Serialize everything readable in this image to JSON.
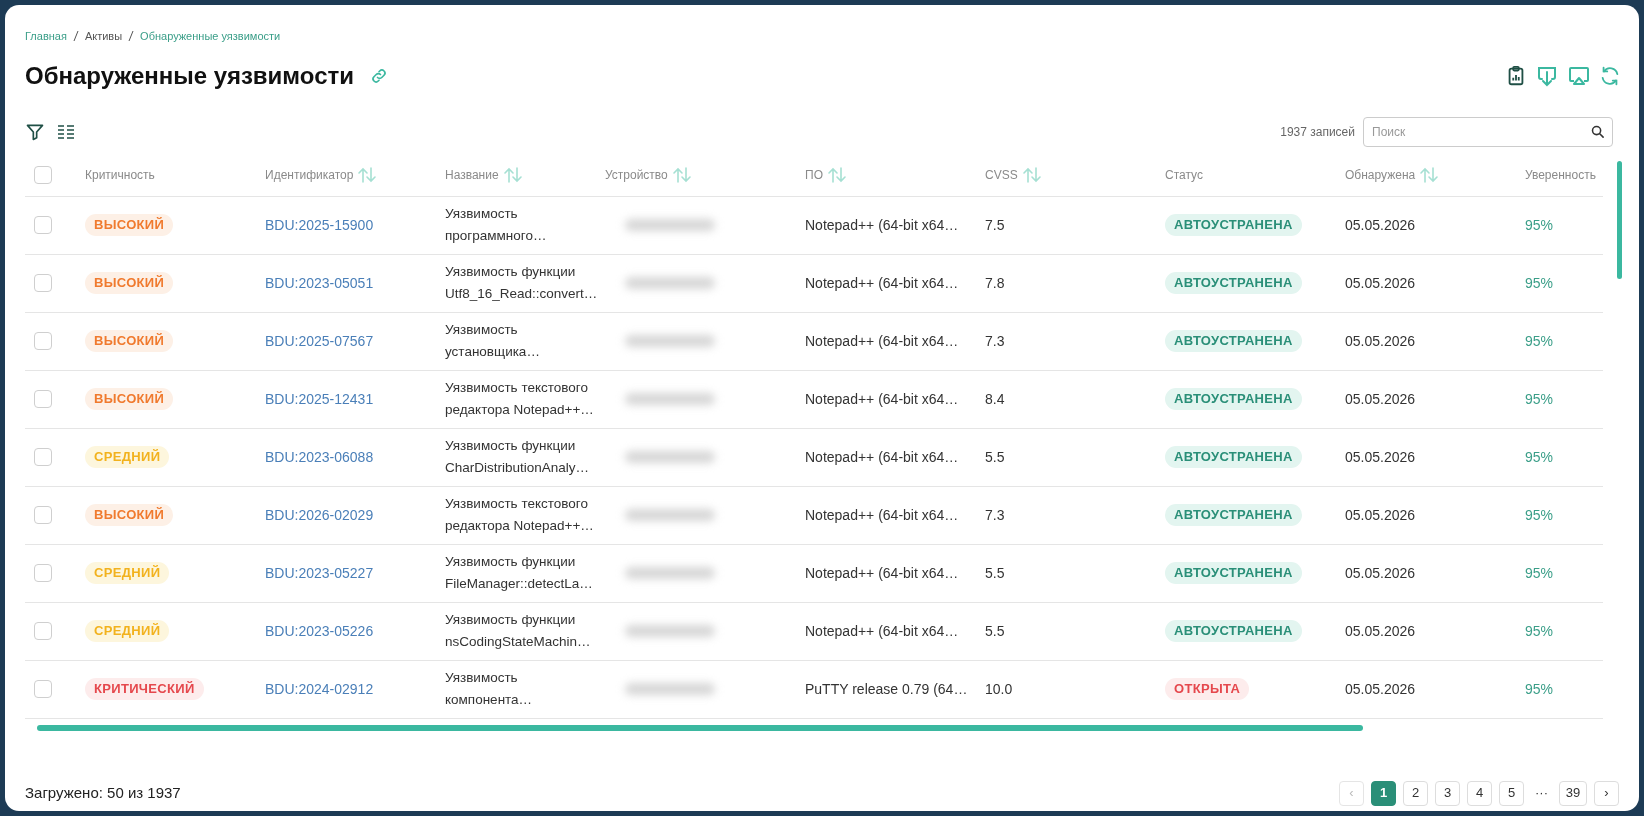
{
  "breadcrumbs": [
    {
      "label": "Главная",
      "kind": "link"
    },
    {
      "label": "Активы",
      "kind": "plain"
    },
    {
      "label": "Обнаруженные уязвимости",
      "kind": "link"
    }
  ],
  "title": "Обнаруженные уязвимости",
  "record_count": "1937 записей",
  "search": {
    "placeholder": "Поиск"
  },
  "table": {
    "select_all_checked": false,
    "columns": [
      {
        "label": "Критичность",
        "sortable": false
      },
      {
        "label": "Идентификатор",
        "sortable": true
      },
      {
        "label": "Название",
        "sortable": true
      },
      {
        "label": "Устройство",
        "sortable": true
      },
      {
        "label": "ПО",
        "sortable": true
      },
      {
        "label": "CVSS",
        "sortable": true
      },
      {
        "label": "Статус",
        "sortable": false
      },
      {
        "label": "Обнаружена",
        "sortable": true
      },
      {
        "label": "Уверенность",
        "sortable": false
      }
    ],
    "rows": [
      {
        "checked": false,
        "severity": {
          "label": "ВЫСОКИЙ",
          "kind": "high"
        },
        "id": "BDU:2025-15900",
        "name": "Уязвимость программного…",
        "software": "Notepad++ (64-bit x64…",
        "cvss": "7.5",
        "status": {
          "label": "АВТОУСТРАНЕНА",
          "kind": "fixed"
        },
        "found": "05.05.2026",
        "confidence": "95%"
      },
      {
        "checked": false,
        "severity": {
          "label": "ВЫСОКИЙ",
          "kind": "high"
        },
        "id": "BDU:2023-05051",
        "name": "Уязвимость функции Utf8_16_Read::convert…",
        "software": "Notepad++ (64-bit x64…",
        "cvss": "7.8",
        "status": {
          "label": "АВТОУСТРАНЕНА",
          "kind": "fixed"
        },
        "found": "05.05.2026",
        "confidence": "95%"
      },
      {
        "checked": false,
        "severity": {
          "label": "ВЫСОКИЙ",
          "kind": "high"
        },
        "id": "BDU:2025-07567",
        "name": "Уязвимость установщика…",
        "software": "Notepad++ (64-bit x64…",
        "cvss": "7.3",
        "status": {
          "label": "АВТОУСТРАНЕНА",
          "kind": "fixed"
        },
        "found": "05.05.2026",
        "confidence": "95%"
      },
      {
        "checked": false,
        "severity": {
          "label": "ВЫСОКИЙ",
          "kind": "high"
        },
        "id": "BDU:2025-12431",
        "name": "Уязвимость текстового редактора Notepad++…",
        "software": "Notepad++ (64-bit x64…",
        "cvss": "8.4",
        "status": {
          "label": "АВТОУСТРАНЕНА",
          "kind": "fixed"
        },
        "found": "05.05.2026",
        "confidence": "95%"
      },
      {
        "checked": false,
        "severity": {
          "label": "СРЕДНИЙ",
          "kind": "medium"
        },
        "id": "BDU:2023-06088",
        "name": "Уязвимость функции CharDistributionAnaly…",
        "software": "Notepad++ (64-bit x64…",
        "cvss": "5.5",
        "status": {
          "label": "АВТОУСТРАНЕНА",
          "kind": "fixed"
        },
        "found": "05.05.2026",
        "confidence": "95%"
      },
      {
        "checked": false,
        "severity": {
          "label": "ВЫСОКИЙ",
          "kind": "high"
        },
        "id": "BDU:2026-02029",
        "name": "Уязвимость текстового редактора Notepad++…",
        "software": "Notepad++ (64-bit x64…",
        "cvss": "7.3",
        "status": {
          "label": "АВТОУСТРАНЕНА",
          "kind": "fixed"
        },
        "found": "05.05.2026",
        "confidence": "95%"
      },
      {
        "checked": false,
        "severity": {
          "label": "СРЕДНИЙ",
          "kind": "medium"
        },
        "id": "BDU:2023-05227",
        "name": "Уязвимость функции FileManager::detectLa…",
        "software": "Notepad++ (64-bit x64…",
        "cvss": "5.5",
        "status": {
          "label": "АВТОУСТРАНЕНА",
          "kind": "fixed"
        },
        "found": "05.05.2026",
        "confidence": "95%"
      },
      {
        "checked": false,
        "severity": {
          "label": "СРЕДНИЙ",
          "kind": "medium"
        },
        "id": "BDU:2023-05226",
        "name": "Уязвимость функции nsCodingStateMachin…",
        "software": "Notepad++ (64-bit x64…",
        "cvss": "5.5",
        "status": {
          "label": "АВТОУСТРАНЕНА",
          "kind": "fixed"
        },
        "found": "05.05.2026",
        "confidence": "95%"
      },
      {
        "checked": false,
        "severity": {
          "label": "КРИТИЧЕСКИЙ",
          "kind": "critical"
        },
        "id": "BDU:2024-02912",
        "name": "Уязвимость компонента…",
        "software": "PuTTY release 0.79 (64…",
        "cvss": "10.0",
        "status": {
          "label": "ОТКРЫТА",
          "kind": "open"
        },
        "found": "05.05.2026",
        "confidence": "95%"
      }
    ]
  },
  "loaded": "Загружено: 50 из 1937",
  "pagination": {
    "prev": "‹",
    "next": "›",
    "ellipsis": "···",
    "pages": [
      {
        "label": "1",
        "selected": true
      },
      {
        "label": "2",
        "selected": false
      },
      {
        "label": "3",
        "selected": false
      },
      {
        "label": "4",
        "selected": false
      },
      {
        "label": "5",
        "selected": false
      },
      {
        "label": "39",
        "selected": false
      }
    ]
  }
}
